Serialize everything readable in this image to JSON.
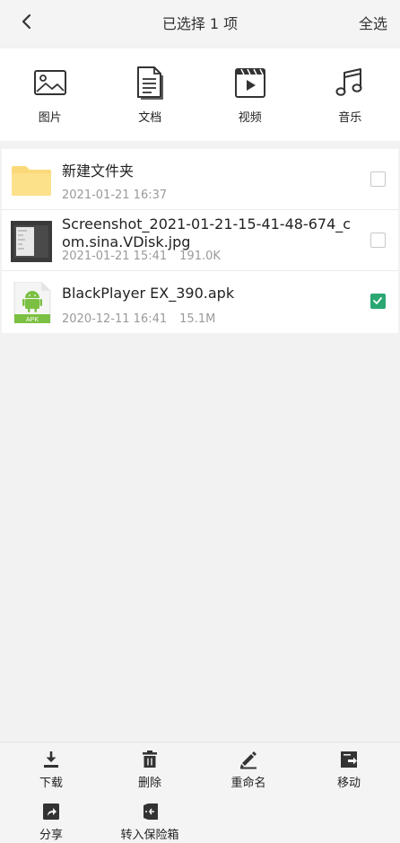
{
  "header": {
    "title": "已选择 1 项",
    "select_all": "全选"
  },
  "categories": [
    {
      "label": "图片",
      "icon": "image-icon"
    },
    {
      "label": "文档",
      "icon": "document-icon"
    },
    {
      "label": "视频",
      "icon": "video-icon"
    },
    {
      "label": "音乐",
      "icon": "music-icon"
    }
  ],
  "files": [
    {
      "name": "新建文件夹",
      "date": "2021-01-21 16:37",
      "size": "",
      "type": "folder",
      "checked": false
    },
    {
      "name": "Screenshot_2021-01-21-15-41-48-674_com.sina.VDisk.jpg",
      "date": "2021-01-21 15:41",
      "size": "191.0K",
      "type": "image",
      "checked": false
    },
    {
      "name": "BlackPlayer EX_390.apk",
      "date": "2020-12-11 16:41",
      "size": "15.1M",
      "type": "apk",
      "apk_label": "APK",
      "checked": true
    }
  ],
  "actions": [
    {
      "label": "下载",
      "icon": "download-icon"
    },
    {
      "label": "删除",
      "icon": "trash-icon"
    },
    {
      "label": "重命名",
      "icon": "pencil-icon"
    },
    {
      "label": "移动",
      "icon": "move-icon"
    },
    {
      "label": "分享",
      "icon": "share-icon"
    },
    {
      "label": "转入保险箱",
      "icon": "safe-icon"
    }
  ],
  "colors": {
    "accent": "#2aa772",
    "folder": "#fbd97a",
    "android": "#7cc043"
  }
}
